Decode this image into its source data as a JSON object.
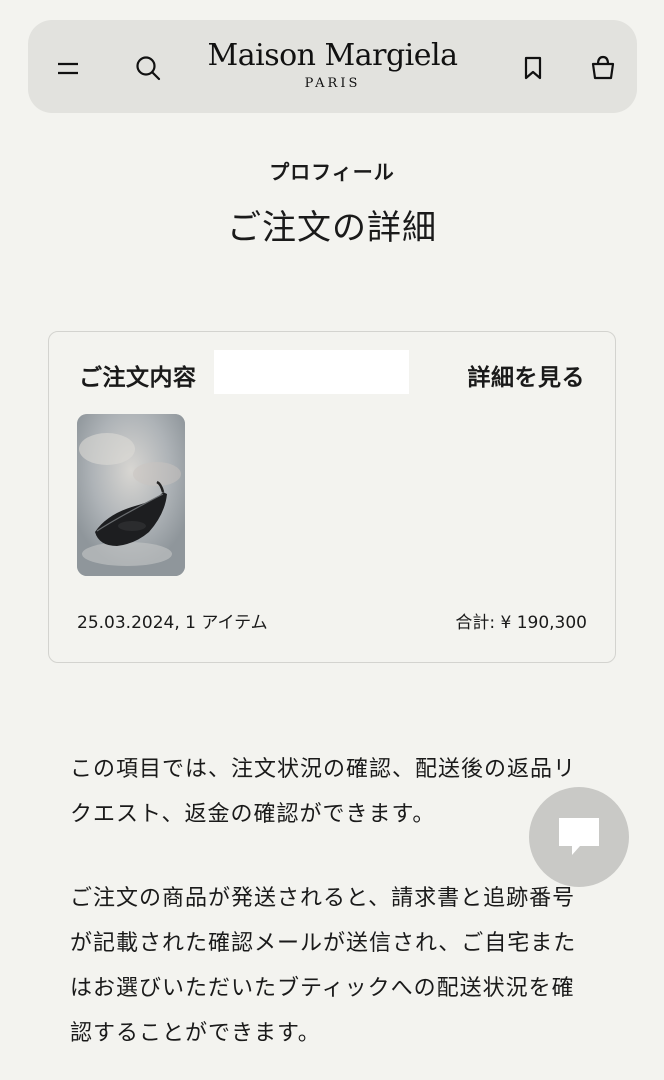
{
  "header": {
    "brand_name": "Maison Margiela",
    "brand_sub": "PARIS",
    "icons": {
      "menu": "menu-icon",
      "search": "search-icon",
      "bookmark": "bookmark-icon",
      "bag": "shopping-bag-icon"
    }
  },
  "page": {
    "section_label": "プロフィール",
    "title": "ご注文の詳細"
  },
  "order": {
    "title": "ご注文内容",
    "details_link": "詳細を見る",
    "date_items": "25.03.2024, 1 アイテム",
    "total": "合計: ¥ 190,300"
  },
  "description": {
    "paragraph1": "この項目では、注文状況の確認、配送後の返品リクエスト、返金の確認ができます。",
    "paragraph2": "ご注文の商品が発送されると、請求書と追跡番号が記載された確認メールが送信され、ご自宅またはお選びいただいたブティックへの配送状況を確認することができます。"
  },
  "chat": {
    "icon": "chat-bubble-icon"
  }
}
